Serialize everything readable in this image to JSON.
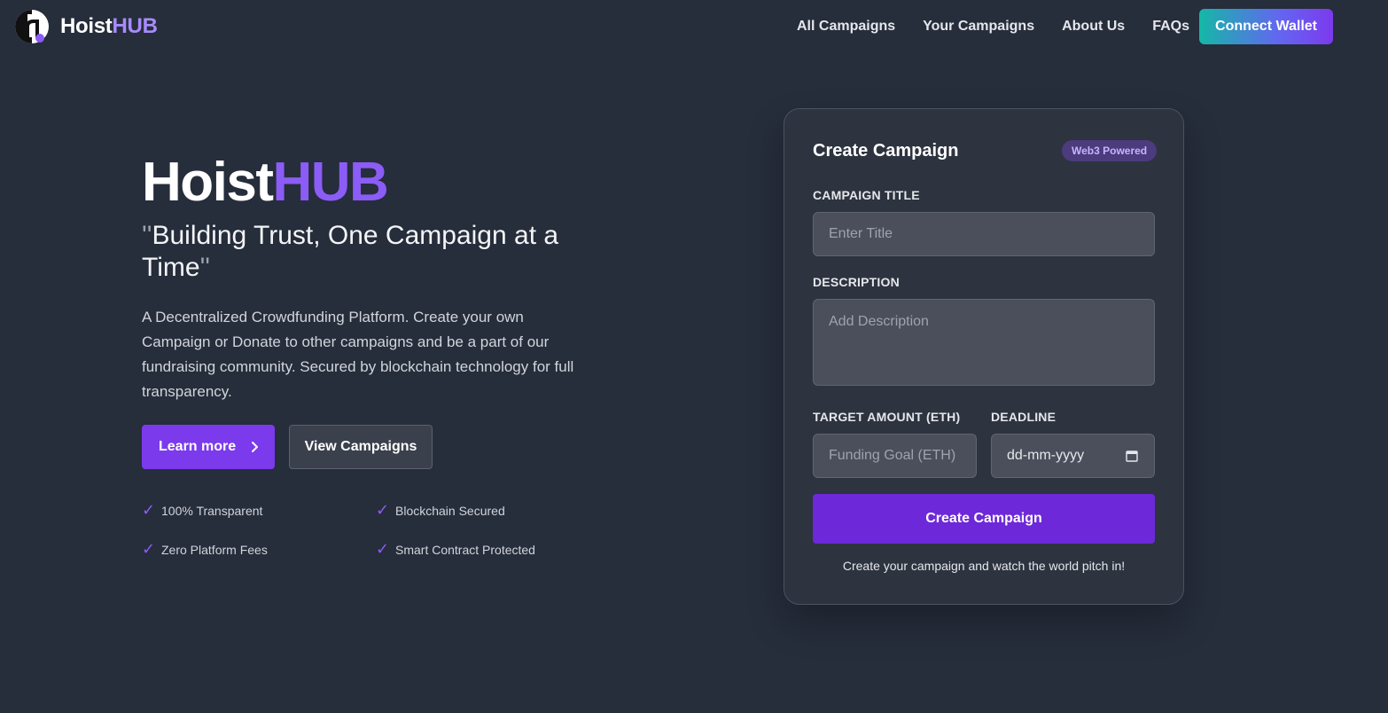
{
  "brand": {
    "name_main": "Hoist",
    "name_accent": "HUB"
  },
  "nav": {
    "links": [
      "All Campaigns",
      "Your Campaigns",
      "About Us",
      "FAQs"
    ],
    "connect_label": "Connect Wallet"
  },
  "hero": {
    "title_main": "Hoist",
    "title_accent": "HUB",
    "quote_open": "''",
    "tagline": "Building Trust, One Campaign at a Time",
    "quote_close": "''",
    "description": "A Decentralized Crowdfunding Platform. Create your own Campaign or Donate to other campaigns and be a part of our fundraising community. Secured by blockchain technology for full transparency.",
    "learn_more_label": "Learn more",
    "view_campaigns_label": "View Campaigns",
    "features": [
      "100% Transparent",
      "Blockchain Secured",
      "Zero Platform Fees",
      "Smart Contract Protected"
    ]
  },
  "form": {
    "title": "Create Campaign",
    "badge": "Web3 Powered",
    "title_label": "CAMPAIGN TITLE",
    "title_placeholder": "Enter Title",
    "description_label": "DESCRIPTION",
    "description_placeholder": "Add Description",
    "target_label": "TARGET AMOUNT (ETH)",
    "target_placeholder": "Funding Goal (ETH)",
    "deadline_label": "DEADLINE",
    "deadline_placeholder": "dd-mm-yyyy",
    "submit_label": "Create Campaign",
    "footer_text": "Create your campaign and watch the world pitch in!"
  },
  "colors": {
    "background": "#262d3b",
    "accent_purple": "#7c3aed",
    "accent_light": "#a78bfa",
    "card": "#2d333f"
  },
  "icons": {
    "logo": "hoisthub-logo-icon",
    "chevron": "chevron-right-icon",
    "check": "check-icon",
    "calendar": "calendar-icon"
  }
}
